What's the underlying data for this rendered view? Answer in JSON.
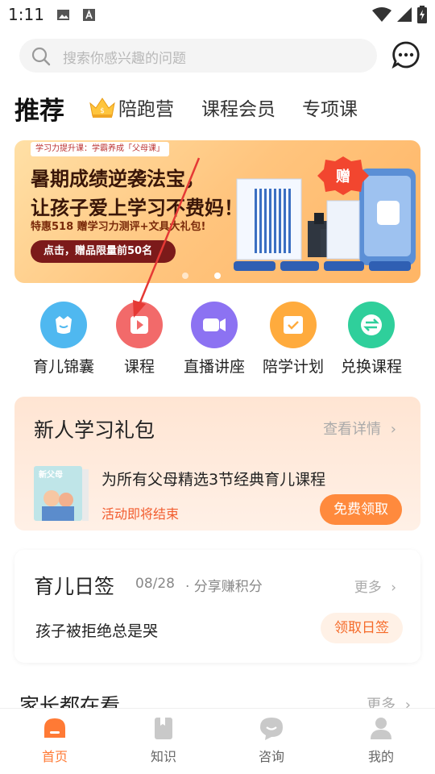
{
  "status_bar": {
    "time": "1:11"
  },
  "search": {
    "placeholder": "搜索你感兴趣的问题"
  },
  "tabs": [
    {
      "label": "推荐"
    },
    {
      "label": "陪跑营"
    },
    {
      "label": "课程会员"
    },
    {
      "label": "专项课"
    }
  ],
  "banner": {
    "tag": "学习力提升课：学霸养成「父母课」",
    "headline_1": "暑期成绩逆袭法宝，",
    "headline_2": "让孩子爱上学习不费妈！",
    "subline": "特惠518 赠学习力测评+文具大礼包!",
    "cta": "点击，赠品限量前50名",
    "badge": "赠"
  },
  "quick_links": [
    {
      "label": "育儿锦囊",
      "color": "#4fb8f0"
    },
    {
      "label": "课程",
      "color": "#f26a6a"
    },
    {
      "label": "直播讲座",
      "color": "#8c72f2"
    },
    {
      "label": "陪学计划",
      "color": "#ffab3d"
    },
    {
      "label": "兑换课程",
      "color": "#2fcf9b"
    }
  ],
  "gift_pack": {
    "title": "新人学习礼包",
    "more": "查看详情",
    "description": "为所有父母精选3节经典育儿课程",
    "notice": "活动即将结束",
    "button": "免费领取",
    "cover_text": "新父母"
  },
  "daily_sign": {
    "title": "育儿日签",
    "date": "08/28",
    "share": "· 分享赚积分",
    "more": "更多",
    "text": "孩子被拒绝总是哭",
    "button": "领取日签"
  },
  "parents_section": {
    "title": "家长都在看",
    "more": "更多"
  },
  "bottom_nav": [
    {
      "label": "首页",
      "active": true
    },
    {
      "label": "知识",
      "active": false
    },
    {
      "label": "咨询",
      "active": false
    },
    {
      "label": "我的",
      "active": false
    }
  ],
  "colors": {
    "accent": "#ff7a35",
    "annotation_arrow": "#e53935"
  }
}
